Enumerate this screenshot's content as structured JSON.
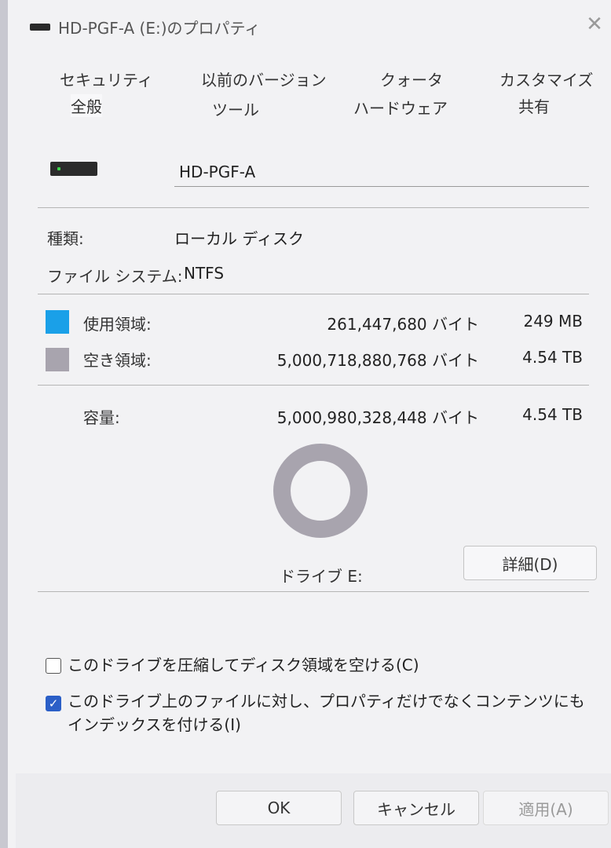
{
  "window": {
    "title": "HD-PGF-A (E:)のプロパティ",
    "close_glyph": "✕"
  },
  "tabs": {
    "row1": [
      "セキュリティ",
      "以前のバージョン",
      "クォータ",
      "カスタマイズ"
    ],
    "row2": [
      "全般",
      "ツール",
      "ハードウェア",
      "共有"
    ],
    "active": "全般"
  },
  "general": {
    "drive_name": "HD-PGF-A",
    "type_label": "種類:",
    "type_value": "ローカル ディスク",
    "fs_label": "ファイル システム:",
    "fs_value": "NTFS"
  },
  "usage": {
    "used_label": "使用領域:",
    "used_bytes": "261,447,680 バイト",
    "used_size": "249 MB",
    "used_color": "#1aa0e8",
    "free_label": "空き領域:",
    "free_bytes": "5,000,718,880,768 バイト",
    "free_size": "4.54 TB",
    "free_color": "#a8a4ae",
    "capacity_label": "容量:",
    "capacity_bytes": "5,000,980,328,448 バイト",
    "capacity_size": "4.54 TB",
    "used_fraction": 5.23e-05
  },
  "drive_label": "ドライブ E:",
  "detail_button": "詳細(D)",
  "options": {
    "compress_label": "このドライブを圧縮してディスク領域を空ける(C)",
    "compress_checked": false,
    "index_label": "このドライブ上のファイルに対し、プロパティだけでなくコンテンツにもインデックスを付ける(I)",
    "index_checked": true
  },
  "footer": {
    "ok": "OK",
    "cancel": "キャンセル",
    "apply": "適用(A)"
  }
}
